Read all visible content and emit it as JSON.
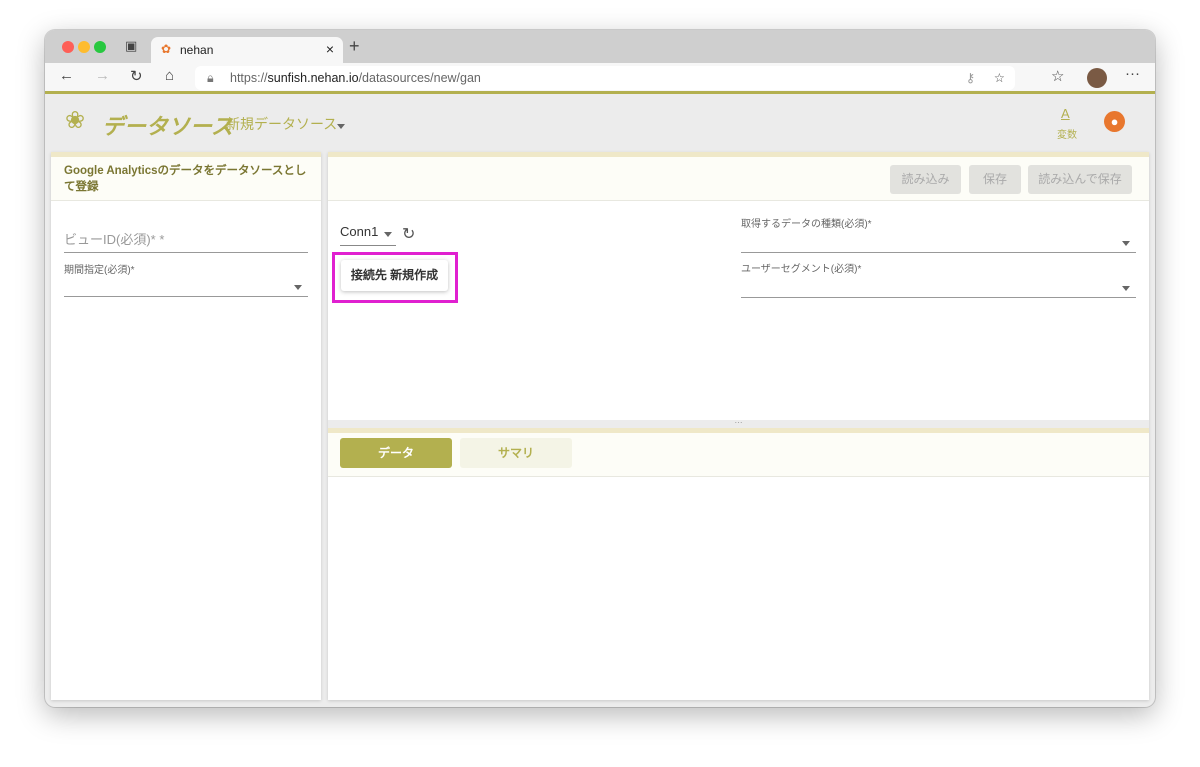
{
  "browser": {
    "tab_title": "nehan",
    "url_prefix": "https://",
    "url_host": "sunfish.nehan.io",
    "url_path": "/datasources/new/gan"
  },
  "header": {
    "title": "データソース",
    "subtitle": "新規データソース",
    "variables_label": "変数",
    "variables_icon": "A"
  },
  "left_panel": {
    "title": "Google Analyticsのデータをデータソースとして登録",
    "view_id_placeholder": "ビューID(必須)* *",
    "period_label": "期間指定(必須)*"
  },
  "toolbar": {
    "load": "読み込み",
    "save": "保存",
    "load_save": "読み込んで保存"
  },
  "connection": {
    "selected": "Conn1",
    "new_button": "接続先 新規作成"
  },
  "fields": {
    "data_type_label": "取得するデータの種類(必須)*",
    "segment_label": "ユーザーセグメント(必須)*"
  },
  "tabs": {
    "data": "データ",
    "summary": "サマリ"
  },
  "colors": {
    "accent": "#b3b04f",
    "highlight": "#e020d0",
    "user": "#e8772e"
  }
}
